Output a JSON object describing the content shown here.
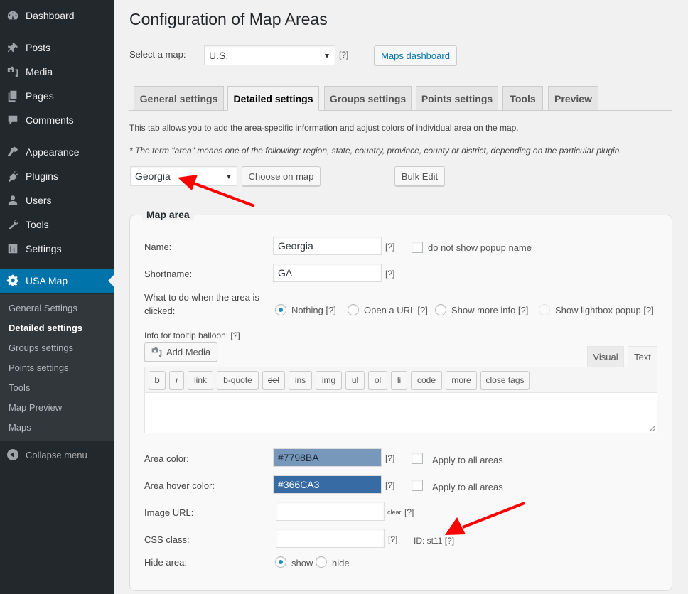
{
  "sidebar": {
    "items": [
      {
        "label": "Dashboard",
        "icon": "dashboard-icon"
      },
      {
        "label": "Posts",
        "icon": "pin-icon"
      },
      {
        "label": "Media",
        "icon": "media-icon"
      },
      {
        "label": "Pages",
        "icon": "pages-icon"
      },
      {
        "label": "Comments",
        "icon": "comment-icon"
      },
      {
        "label": "Appearance",
        "icon": "paintbrush-icon"
      },
      {
        "label": "Plugins",
        "icon": "plug-icon"
      },
      {
        "label": "Users",
        "icon": "user-icon"
      },
      {
        "label": "Tools",
        "icon": "wrench-icon"
      },
      {
        "label": "Settings",
        "icon": "settings-sliders-icon"
      },
      {
        "label": "USA Map",
        "icon": "gear-icon",
        "current": true
      }
    ],
    "submenu": [
      {
        "label": "General Settings"
      },
      {
        "label": "Detailed settings",
        "active": true
      },
      {
        "label": "Groups settings"
      },
      {
        "label": "Points settings"
      },
      {
        "label": "Tools"
      },
      {
        "label": "Map Preview"
      },
      {
        "label": "Maps"
      }
    ],
    "collapse_label": "Collapse menu"
  },
  "page": {
    "title": "Configuration of Map Areas",
    "select_map_label": "Select a map:",
    "select_map_value": "U.S.",
    "help": "[?]",
    "maps_dashboard_button": "Maps dashboard",
    "tabs": [
      {
        "label": "General settings"
      },
      {
        "label": "Detailed settings",
        "active": true
      },
      {
        "label": "Groups settings"
      },
      {
        "label": "Points settings"
      },
      {
        "label": "Tools"
      },
      {
        "label": "Preview"
      }
    ],
    "description": "This tab allows you to add the area-specific information and adjust colors of individual area on the map.",
    "note": "* The term \"area\" means one of the following: region, state, country, province, county or district, depending on the particular plugin.",
    "area_select_value": "Georgia",
    "choose_on_map_button": "Choose on map",
    "bulk_edit_button": "Bulk Edit"
  },
  "map_area": {
    "legend": "Map area",
    "name_label": "Name:",
    "name_value": "Georgia",
    "no_popup_label": "do not show popup name",
    "shortname_label": "Shortname:",
    "shortname_value": "GA",
    "click_action_label": "What to do when the area is clicked:",
    "click_action_options": [
      {
        "label": "Nothing [?]",
        "checked": true
      },
      {
        "label": "Open a URL [?]"
      },
      {
        "label": "Show more info [?]"
      },
      {
        "label": "Show lightbox popup [?]",
        "disabled": true
      }
    ],
    "tooltip_label": "Info for tooltip balloon: [?]",
    "add_media_button": "Add Media",
    "editor_tabs": {
      "visual": "Visual",
      "text": "Text"
    },
    "quicktags": [
      "b",
      "i",
      "link",
      "b-quote",
      "del",
      "ins",
      "img",
      "ul",
      "ol",
      "li",
      "code",
      "more",
      "close tags"
    ],
    "tooltip_content": "",
    "area_color_label": "Area color:",
    "area_color_value": "#7798BA",
    "area_hover_color_label": "Area hover color:",
    "area_hover_color_value": "#366CA3",
    "apply_all_label": "Apply to all areas",
    "image_url_label": "Image URL:",
    "image_url_value": "",
    "clear_label": "clear",
    "css_class_label": "CSS class:",
    "css_class_value": "",
    "id_label": "ID: st11 [?]",
    "hide_area_label": "Hide area:",
    "hide_options": [
      {
        "label": "show",
        "checked": true
      },
      {
        "label": "hide"
      }
    ]
  },
  "colors": {
    "sidebar_bg": "#23282d",
    "accent": "#0073aa",
    "area_color": "#7798BA",
    "area_hover_color": "#366CA3",
    "annotation_arrow": "#ff0000"
  }
}
